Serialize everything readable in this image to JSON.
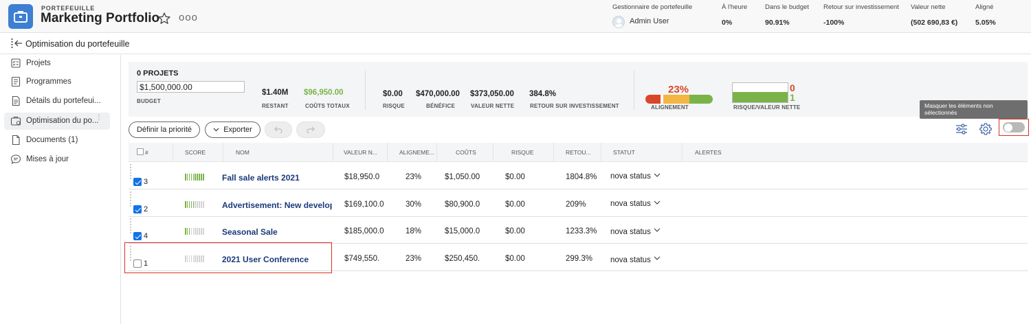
{
  "header": {
    "kicker": "PORTEFEUILLE",
    "title": "Marketing Portfolio",
    "more": "ooo",
    "stats": [
      {
        "label": "Gestionnaire de portefeuille",
        "value": "Admin User"
      },
      {
        "label": "À l'heure",
        "value": "0%"
      },
      {
        "label": "Dans le budget",
        "value": "90.91%"
      },
      {
        "label": "Retour sur investissement",
        "value": "-100%"
      },
      {
        "label": "Valeur nette",
        "value": "(502 690,83 €)"
      },
      {
        "label": "Aligné",
        "value": "5.05%"
      }
    ]
  },
  "page": {
    "title": "Optimisation du portefeuille"
  },
  "sidebar": {
    "items": [
      {
        "label": "Projets",
        "icon": "projects-icon"
      },
      {
        "label": "Programmes",
        "icon": "programs-icon"
      },
      {
        "label": "Détails du portefeui...",
        "icon": "details-icon"
      },
      {
        "label": "Optimisation du po...",
        "icon": "optimization-icon",
        "active": true
      },
      {
        "label": "Documents (1)",
        "icon": "document-icon"
      },
      {
        "label": "Mises à jour",
        "icon": "comment-icon"
      }
    ]
  },
  "summary": {
    "title": "0 PROJETS",
    "budget_value": "$1,500,000.00",
    "budget_label": "BUDGET",
    "restant": {
      "value": "$1.40M",
      "label": "RESTANT"
    },
    "couts": {
      "value": "$96,950.00",
      "label": "COÛTS TOTAUX"
    },
    "risque": {
      "value": "$0.00",
      "label": "RISQUE"
    },
    "benefice": {
      "value": "$470,000.00",
      "label": "BÉNÉFICE"
    },
    "valeur": {
      "value": "$373,050.00",
      "label": "VALEUR NETTE"
    },
    "retour": {
      "value": "384.8%",
      "label": "RETOUR SUR INVESTISSEMENT"
    },
    "alignement": {
      "value": "23%",
      "label": "ALIGNEMENT"
    },
    "risk_value": {
      "top": "0",
      "bottom": "1",
      "label": "RISQUE/VALEUR NETTE"
    }
  },
  "tooltip": "Masquer les éléments non sélectionnés",
  "toolbar": {
    "prioritize": "Définir la priorité",
    "export": "Exporter"
  },
  "table": {
    "columns": [
      "#",
      "SCORE",
      "NOM",
      "VALEUR N...",
      "ALIGNEME...",
      "COÛTS",
      "RISQUE",
      "RETOU...",
      "STATUT",
      "ALERTES"
    ],
    "rows": [
      {
        "checked": true,
        "num": "3",
        "score": 10,
        "name": "Fall sale alerts 2021",
        "valeur": "$18,950.0",
        "align": "23%",
        "couts": "$1,050.00",
        "risque": "$0.00",
        "retour": "1804.8%",
        "statut": "nova status"
      },
      {
        "checked": true,
        "num": "2",
        "score": 5,
        "name": "Advertisement: New development",
        "valeur": "$169,100.0",
        "align": "30%",
        "couts": "$80,900.0",
        "risque": "$0.00",
        "retour": "209%",
        "statut": "nova status"
      },
      {
        "checked": true,
        "num": "4",
        "score": 3,
        "name": "Seasonal Sale",
        "valeur": "$185,000.0",
        "align": "18%",
        "couts": "$15,000.0",
        "risque": "$0.00",
        "retour": "1233.3%",
        "statut": "nova status"
      },
      {
        "checked": false,
        "num": "1",
        "score": 0,
        "name": "2021 User Conference",
        "valeur": "$749,550.",
        "align": "23%",
        "couts": "$250,450.",
        "risque": "$0.00",
        "retour": "299.3%",
        "statut": "nova status"
      }
    ]
  },
  "colors": {
    "accent": "#1473e6",
    "green": "#7bb34b",
    "red": "#d9472b",
    "link": "#1b3a7a"
  }
}
